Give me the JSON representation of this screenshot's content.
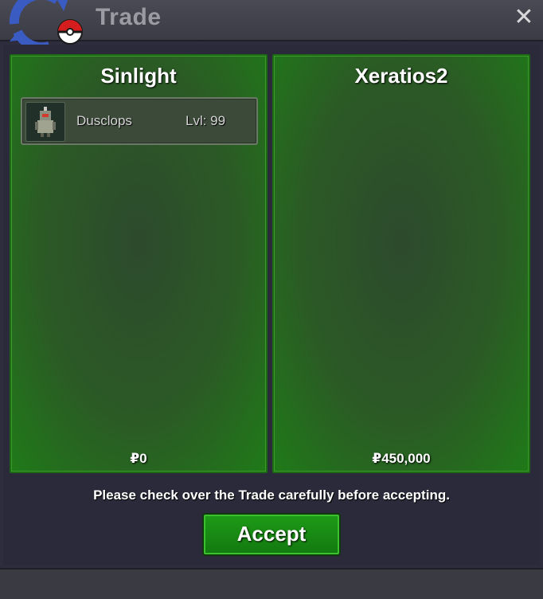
{
  "window": {
    "title": "Trade",
    "close_glyph": "✕"
  },
  "left_panel": {
    "player": "Sinlight",
    "money": "₽0",
    "items": [
      {
        "name": "Dusclops",
        "level": "Lvl: 99",
        "icon": "dusclops-sprite-icon"
      }
    ]
  },
  "right_panel": {
    "player": "Xeratios2",
    "money": "₽450,000",
    "items": []
  },
  "notice": "Please check over the Trade carefully before accepting.",
  "accept_button": {
    "label": "Accept"
  },
  "colors": {
    "accent_green": "#1d9a17",
    "panel_green": "#2b5a25",
    "window_bg": "#2e2d3d"
  }
}
